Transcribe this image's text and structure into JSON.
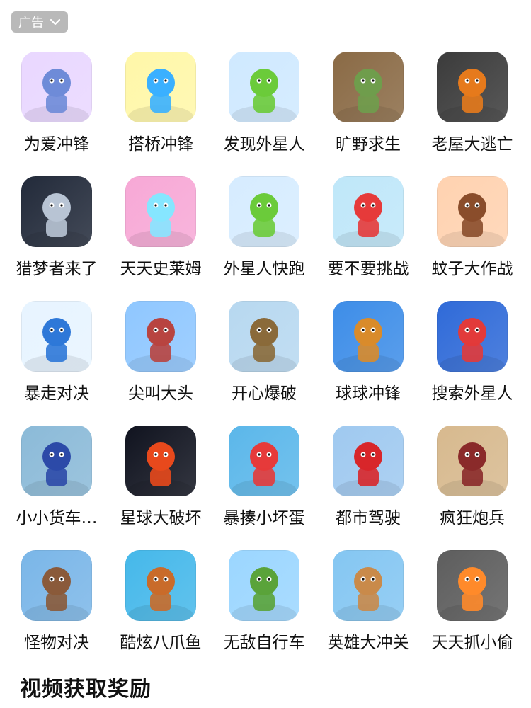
{
  "ad_badge": {
    "label": "广告",
    "icon": "chevron-down-icon"
  },
  "games": [
    {
      "name": "为爱冲锋",
      "icon": "bride-run-icon",
      "colors": [
        "#e9d7ff",
        "#6e8bd8"
      ]
    },
    {
      "name": "搭桥冲锋",
      "icon": "bridge-stack-icon",
      "colors": [
        "#fff7a8",
        "#3ab0ff"
      ]
    },
    {
      "name": "发现外星人",
      "icon": "alien-find-icon",
      "colors": [
        "#cfe9ff",
        "#6bcb3a"
      ]
    },
    {
      "name": "旷野求生",
      "icon": "wild-survival-icon",
      "colors": [
        "#8a6a45",
        "#6f9d4c"
      ]
    },
    {
      "name": "老屋大逃亡",
      "icon": "jail-escape-icon",
      "colors": [
        "#3b3b3b",
        "#e67a1c"
      ]
    },
    {
      "name": "猎梦者来了",
      "icon": "dream-hunter-icon",
      "colors": [
        "#222a3a",
        "#b8c4d4"
      ]
    },
    {
      "name": "天天史莱姆",
      "icon": "slime-icon",
      "colors": [
        "#f7a8d6",
        "#86e6ff"
      ]
    },
    {
      "name": "外星人快跑",
      "icon": "alien-run-icon",
      "colors": [
        "#d6ecff",
        "#6bcb3a"
      ]
    },
    {
      "name": "要不要挑战",
      "icon": "challenge-girl-icon",
      "colors": [
        "#bfe7f9",
        "#e63a3a"
      ]
    },
    {
      "name": "蚊子大作战",
      "icon": "mosquito-icon",
      "colors": [
        "#ffd2b0",
        "#8a4d2b"
      ]
    },
    {
      "name": "暴走对决",
      "icon": "stickman-icon",
      "colors": [
        "#e7f4ff",
        "#2e78d8"
      ]
    },
    {
      "name": "尖叫大头",
      "icon": "scream-head-icon",
      "colors": [
        "#8fc7ff",
        "#b84440"
      ]
    },
    {
      "name": "开心爆破",
      "icon": "tnt-icon",
      "colors": [
        "#b7d8f0",
        "#8a6a3a"
      ]
    },
    {
      "name": "球球冲锋",
      "icon": "ball-rush-icon",
      "colors": [
        "#3d8de8",
        "#d98b2b"
      ]
    },
    {
      "name": "搜索外星人",
      "icon": "search-alien-icon",
      "colors": [
        "#2f6ad8",
        "#e23a3a"
      ]
    },
    {
      "name": "小小货车…",
      "icon": "cargo-truck-icon",
      "colors": [
        "#8bbad8",
        "#2c4aa8"
      ]
    },
    {
      "name": "星球大破坏",
      "icon": "planet-smash-icon",
      "colors": [
        "#10131f",
        "#e8491c"
      ]
    },
    {
      "name": "暴揍小坏蛋",
      "icon": "bad-guy-icon",
      "colors": [
        "#5bb7ea",
        "#e63a3a"
      ]
    },
    {
      "name": "都市驾驶",
      "icon": "city-drive-icon",
      "colors": [
        "#9fc9f0",
        "#d8262a"
      ]
    },
    {
      "name": "疯狂炮兵",
      "icon": "artillery-icon",
      "colors": [
        "#d7b98e",
        "#8a2a2a"
      ]
    },
    {
      "name": "怪物对决",
      "icon": "monster-duel-icon",
      "colors": [
        "#7ab6e8",
        "#8a5a3a"
      ]
    },
    {
      "name": "酷炫八爪鱼",
      "icon": "octopus-icon",
      "colors": [
        "#45b8ea",
        "#c96b2a"
      ]
    },
    {
      "name": "无敌自行车",
      "icon": "bicycle-icon",
      "colors": [
        "#9bd6ff",
        "#5aa33a"
      ]
    },
    {
      "name": "英雄大冲关",
      "icon": "hero-rush-icon",
      "colors": [
        "#84c6f2",
        "#c98a4a"
      ]
    },
    {
      "name": "天天抓小偷",
      "icon": "police-chase-icon",
      "colors": [
        "#5d5d5d",
        "#ff8a2a"
      ]
    }
  ],
  "footer": {
    "title": "视频获取奖励"
  }
}
